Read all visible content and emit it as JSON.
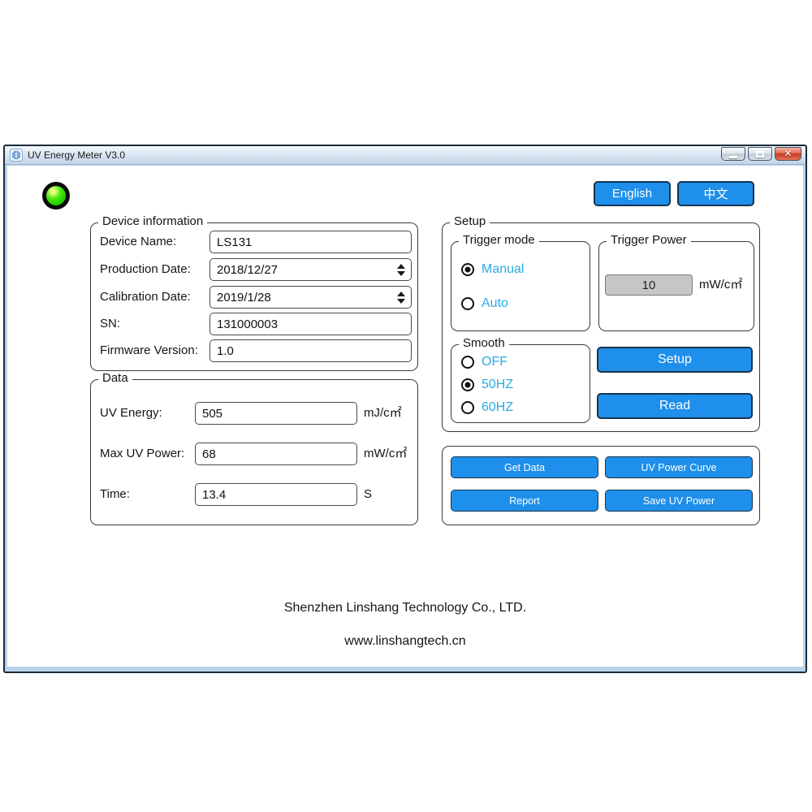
{
  "window": {
    "title": "UV Energy Meter V3.0"
  },
  "header": {
    "english_label": "English",
    "chinese_label": "中文"
  },
  "device_info": {
    "legend": "Device information",
    "fields": [
      {
        "label": "Device Name:",
        "value": "LS131",
        "spinner": false
      },
      {
        "label": "Production Date:",
        "value": "2018/12/27",
        "spinner": true
      },
      {
        "label": "Calibration Date:",
        "value": "2019/1/28",
        "spinner": true
      },
      {
        "label": "SN:",
        "value": "131000003",
        "spinner": false
      },
      {
        "label": "Firmware Version:",
        "value": "1.0",
        "spinner": false
      }
    ]
  },
  "data_group": {
    "legend": "Data",
    "fields": [
      {
        "label": "UV Energy:",
        "value": "505",
        "unit": "mJ/c㎡"
      },
      {
        "label": "Max UV Power:",
        "value": "68",
        "unit": "mW/c㎡"
      },
      {
        "label": "Time:",
        "value": "13.4",
        "unit": "S"
      }
    ]
  },
  "setup": {
    "legend": "Setup",
    "trigger_mode": {
      "legend": "Trigger mode",
      "options": [
        {
          "label": "Manual",
          "selected": true
        },
        {
          "label": "Auto",
          "selected": false
        }
      ]
    },
    "trigger_power": {
      "legend": "Trigger Power",
      "value": "10",
      "unit": "mW/c㎡"
    },
    "smooth": {
      "legend": "Smooth",
      "options": [
        {
          "label": "OFF",
          "selected": false
        },
        {
          "label": "50HZ",
          "selected": true
        },
        {
          "label": "60HZ",
          "selected": false
        }
      ]
    },
    "setup_button": "Setup",
    "read_button": "Read"
  },
  "actions": {
    "get_data": "Get Data",
    "uv_power_curve": "UV Power Curve",
    "report": "Report",
    "save_uv_power": "Save UV Power"
  },
  "footer": {
    "company": "Shenzhen Linshang Technology Co., LTD.",
    "website": "www.linshangtech.cn"
  },
  "colors": {
    "accent_blue": "#1E8FEA",
    "radio_label_blue": "#29ABE2",
    "led_green": "#1ECB00",
    "disabled_input_gray": "#C6C6C6"
  }
}
